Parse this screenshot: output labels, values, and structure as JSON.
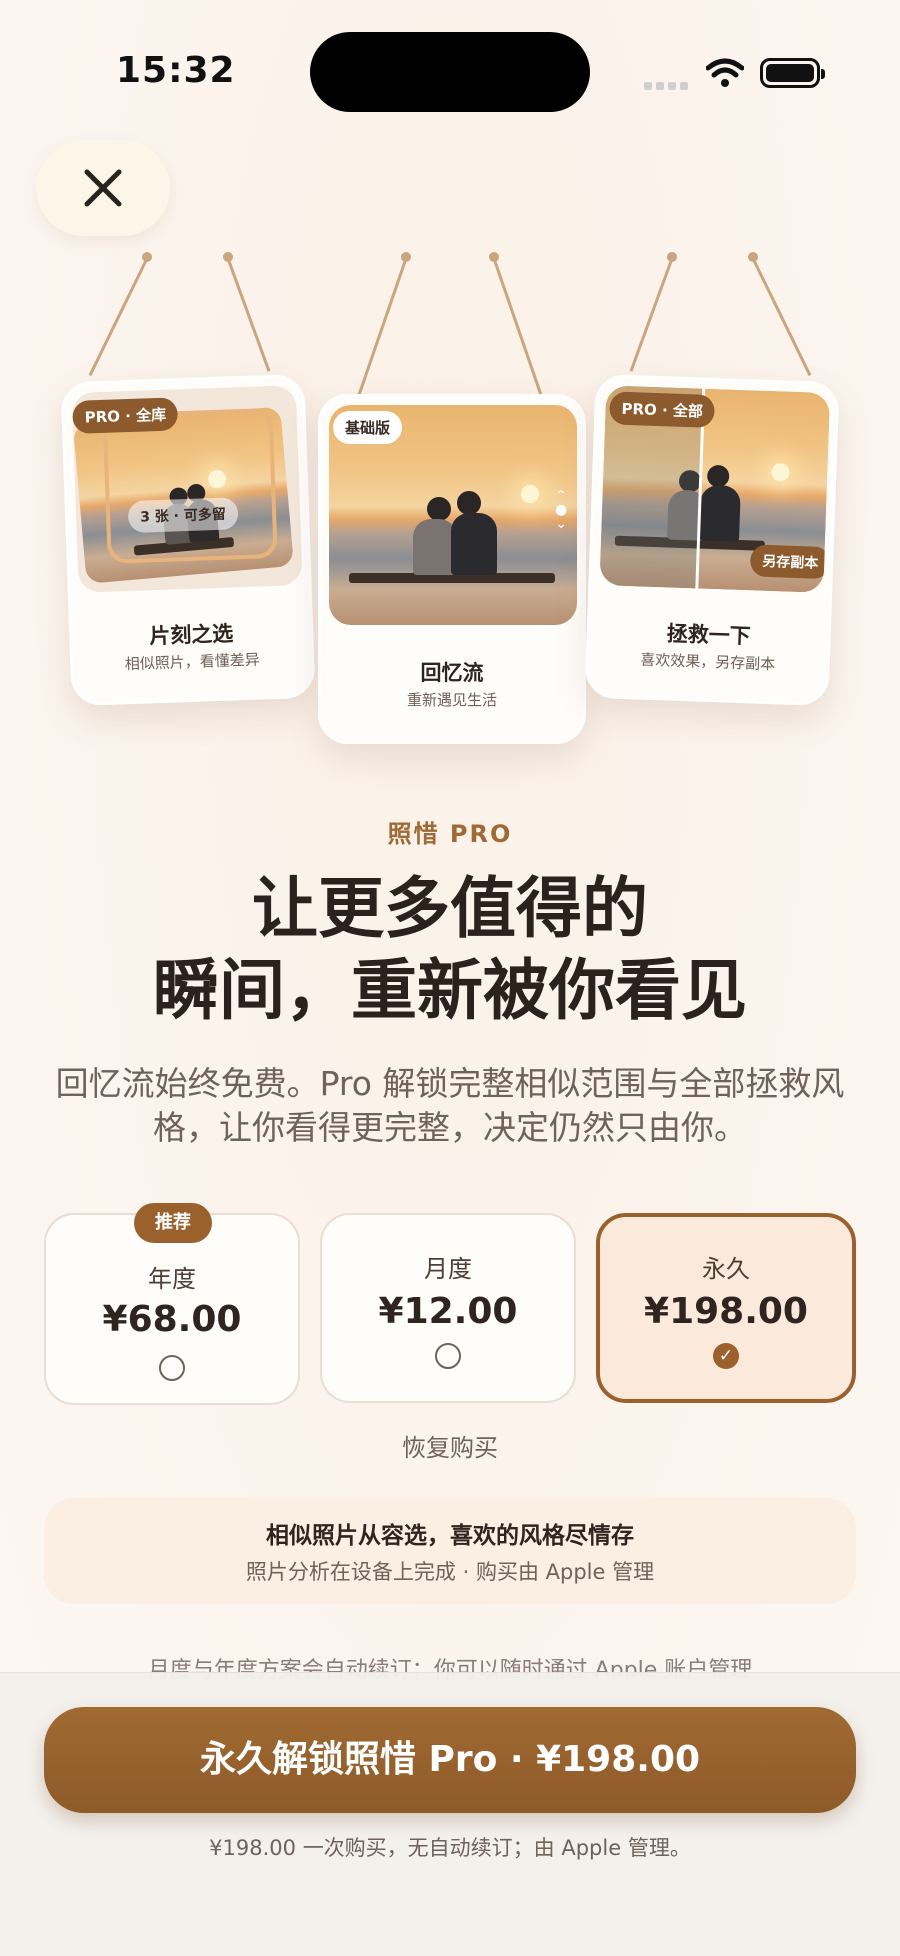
{
  "status_bar": {
    "time": "15:32"
  },
  "cards": [
    {
      "tag": "PRO · 全库",
      "overlay": "3 张 · 可多留",
      "title": "片刻之选",
      "subtitle": "相似照片，看懂差异"
    },
    {
      "tag": "基础版",
      "title": "回忆流",
      "subtitle": "重新遇见生活"
    },
    {
      "tag": "PRO · 全部",
      "overlay": "另存副本",
      "title": "拯救一下",
      "subtitle": "喜欢效果，另存副本"
    }
  ],
  "hero": {
    "eyebrow": "照惜 PRO",
    "headline_line1": "让更多值得的",
    "headline_line2": "瞬间，重新被你看见",
    "description": "回忆流始终免费。Pro 解锁完整相似范围与全部拯救风格，让你看得更完整，决定仍然只由你。"
  },
  "plans": [
    {
      "badge": "推荐",
      "name": "年度",
      "price": "¥68.00",
      "selected": false
    },
    {
      "name": "月度",
      "price": "¥12.00",
      "selected": false
    },
    {
      "name": "永久",
      "price": "¥198.00",
      "selected": true
    }
  ],
  "restore_label": "恢复购买",
  "info_box": {
    "title": "相似照片从容选，喜欢的风格尽情存",
    "subtitle": "照片分析在设备上完成 · 购买由 Apple 管理"
  },
  "peek_text": "月度与年度方案会自动续订；你可以随时通过 Apple 账户管理",
  "cta": {
    "label": "永久解锁照惜 Pro · ¥198.00"
  },
  "footer_note": "¥198.00 一次购买，无自动续订；由 Apple 管理。",
  "colors": {
    "accent": "#9a612d",
    "background": "#fbf3ec",
    "text": "#2c221d"
  }
}
